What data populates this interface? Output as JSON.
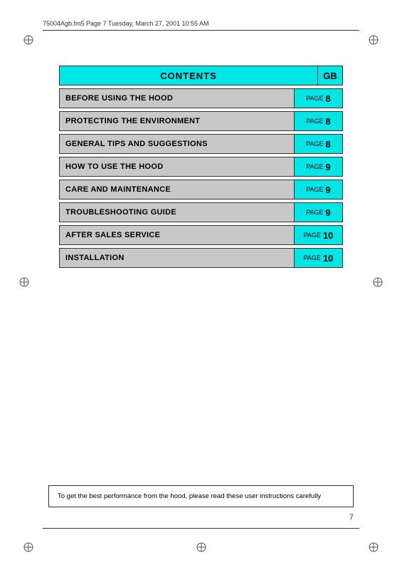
{
  "header": {
    "filename": "75004Agb.fm5  Page 7  Tuesday, March 27, 2001  10:55 AM"
  },
  "contents": {
    "title": "CONTENTS",
    "gb_label": "GB",
    "rows": [
      {
        "label": "BEFORE USING THE HOOD",
        "page_word": "PAGE",
        "page_num": "8"
      },
      {
        "label": "PROTECTING THE ENVIRONMENT",
        "page_word": "PAGE",
        "page_num": "8"
      },
      {
        "label": "GENERAL TIPS AND SUGGESTIONS",
        "page_word": "PAGE",
        "page_num": "8"
      },
      {
        "label": "HOW TO USE THE HOOD",
        "page_word": "PAGE",
        "page_num": "9"
      },
      {
        "label": "CARE AND MAINTENANCE",
        "page_word": "PAGE",
        "page_num": "9"
      },
      {
        "label": "TROUBLESHOOTING GUIDE",
        "page_word": "PAGE",
        "page_num": "9"
      },
      {
        "label": "AFTER SALES SERVICE",
        "page_word": "PAGE",
        "page_num": "10"
      },
      {
        "label": "INSTALLATION",
        "page_word": "PAGE",
        "page_num": "10"
      }
    ]
  },
  "footer": {
    "note": "To get the best performance from the hood, please read these user instructions carefully",
    "page_number": "7"
  }
}
